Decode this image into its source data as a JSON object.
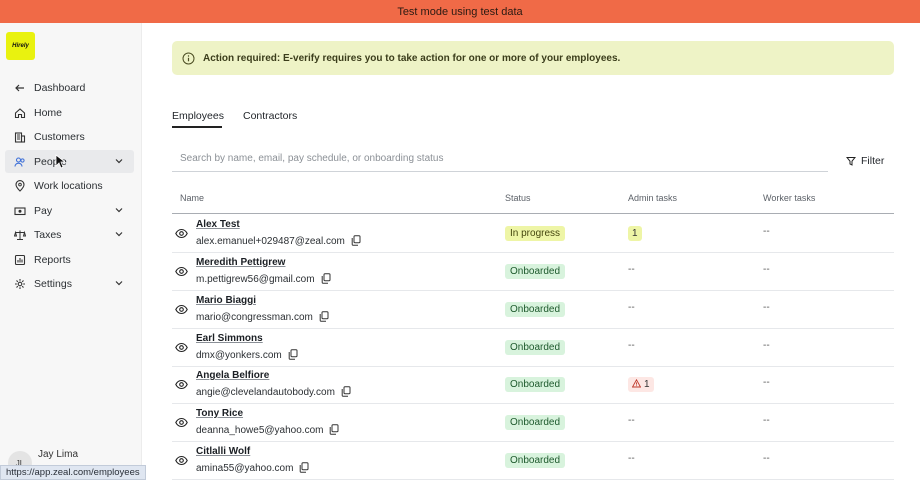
{
  "banner": {
    "text": "Test mode using test data"
  },
  "logo": {
    "text": "Hirely",
    "color": "#e9f20f"
  },
  "sidebar": {
    "items": [
      {
        "label": "Dashboard",
        "icon": "arrow-left-icon"
      },
      {
        "label": "Home",
        "icon": "home-icon"
      },
      {
        "label": "Customers",
        "icon": "building-icon"
      },
      {
        "label": "People",
        "icon": "people-icon",
        "active": true,
        "chevron": true
      },
      {
        "label": "Work locations",
        "icon": "map-pin-icon"
      },
      {
        "label": "Pay",
        "icon": "money-icon",
        "chevron": true
      },
      {
        "label": "Taxes",
        "icon": "scale-icon",
        "chevron": true
      },
      {
        "label": "Reports",
        "icon": "report-icon"
      },
      {
        "label": "Settings",
        "icon": "gear-icon",
        "chevron": true
      }
    ],
    "user": {
      "initials": "JL",
      "name": "Jay Lima"
    }
  },
  "status_url": "https://app.zeal.com/employees",
  "alert": {
    "text": "Action required: E-verify requires you to take action for one or more of your employees."
  },
  "tabs": [
    {
      "label": "Employees",
      "active": true
    },
    {
      "label": "Contractors",
      "active": false
    }
  ],
  "search": {
    "placeholder": "Search by name, email, pay schedule, or onboarding status"
  },
  "filter": {
    "label": "Filter"
  },
  "table": {
    "columns": [
      "Name",
      "Status",
      "Admin tasks",
      "Worker tasks"
    ],
    "rows": [
      {
        "name": "Alex Test",
        "email": "alex.emanuel+029487@zeal.com",
        "status": "In progress",
        "status_type": "progress",
        "admin_tasks": "1",
        "admin_type": "yellow",
        "worker_tasks": "--"
      },
      {
        "name": "Meredith Pettigrew",
        "email": "m.pettigrew56@gmail.com",
        "status": "Onboarded",
        "status_type": "done",
        "admin_tasks": "--",
        "admin_type": "none",
        "worker_tasks": "--"
      },
      {
        "name": "Mario Biaggi",
        "email": "mario@congressman.com",
        "status": "Onboarded",
        "status_type": "done",
        "admin_tasks": "--",
        "admin_type": "none",
        "worker_tasks": "--"
      },
      {
        "name": "Earl Simmons",
        "email": "dmx@yonkers.com",
        "status": "Onboarded",
        "status_type": "done",
        "admin_tasks": "--",
        "admin_type": "none",
        "worker_tasks": "--"
      },
      {
        "name": "Angela Belfiore",
        "email": "angie@clevelandautobody.com",
        "status": "Onboarded",
        "status_type": "done",
        "admin_tasks": "1",
        "admin_type": "red",
        "worker_tasks": "--"
      },
      {
        "name": "Tony Rice",
        "email": "deanna_howe5@yahoo.com",
        "status": "Onboarded",
        "status_type": "done",
        "admin_tasks": "--",
        "admin_type": "none",
        "worker_tasks": "--"
      },
      {
        "name": "Citlalli Wolf",
        "email": "amina55@yahoo.com",
        "status": "Onboarded",
        "status_type": "done",
        "admin_tasks": "--",
        "admin_type": "none",
        "worker_tasks": "--"
      }
    ]
  },
  "colors": {
    "banner": "#f06a47",
    "alert_bg": "#eef3c6",
    "progress_badge": "#eef5a6",
    "onboarded_badge": "#d8f3dd"
  }
}
